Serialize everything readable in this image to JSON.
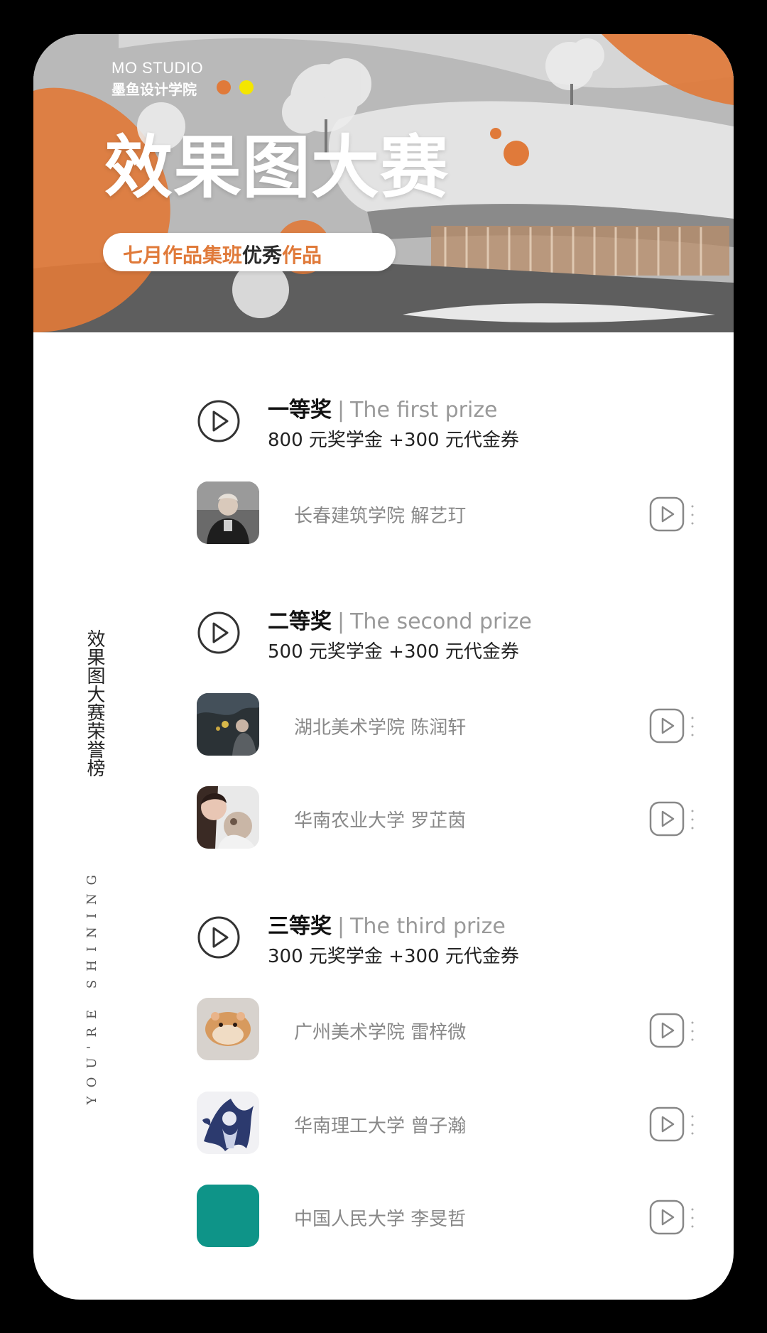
{
  "banner": {
    "brand_en": "MO STUDIO",
    "brand_cn": "墨鱼设计学院",
    "title": "效果图大赛",
    "subtitle_part1": "七月作品集班",
    "subtitle_highlight": "优秀",
    "subtitle_part2": "作品"
  },
  "side": {
    "title_cn": "效果图大赛荣誉榜",
    "title_en": "YOU'RE SHINING"
  },
  "prizes": [
    {
      "title_cn": "一等奖",
      "separator": "|",
      "title_en": "The first prize",
      "amount": "800 元奖学金 +300 元代金券",
      "winners": [
        {
          "name": "长春建筑学院 解艺玎"
        }
      ]
    },
    {
      "title_cn": "二等奖",
      "separator": "|",
      "title_en": "The second prize",
      "amount": "500 元奖学金 +300 元代金券",
      "winners": [
        {
          "name": "湖北美术学院 陈润轩"
        },
        {
          "name": "华南农业大学 罗芷茵"
        }
      ]
    },
    {
      "title_cn": "三等奖",
      "separator": "|",
      "title_en": "The third prize",
      "amount": "300 元奖学金 +300 元代金券",
      "winners": [
        {
          "name": "广州美术学院 雷梓微"
        },
        {
          "name": "华南理工大学 曾子瀚"
        },
        {
          "name": "中国人民大学 李旻哲"
        }
      ]
    }
  ],
  "colors": {
    "accent_orange": "#e07a3a",
    "accent_yellow": "#f4e600",
    "teal_avatar": "#0e9488"
  },
  "icons": {
    "prize_icon": "play-circle-icon",
    "row_icon": "play-square-icon"
  }
}
